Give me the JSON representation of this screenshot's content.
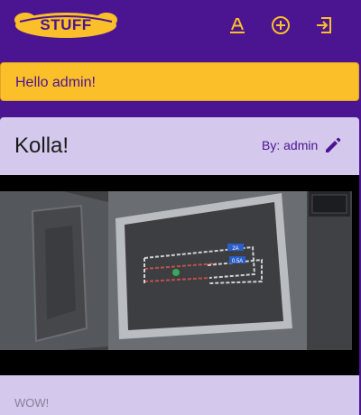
{
  "header": {
    "logo_text": "STUFF",
    "icons": [
      "font-icon",
      "add-circle-icon",
      "login-icon"
    ]
  },
  "banner": {
    "text": "Hello admin!"
  },
  "post": {
    "title": "Kolla!",
    "author": "By: admin",
    "body": "WOW!",
    "media": {
      "labels": [
        "2A",
        "0.5A"
      ]
    }
  },
  "colors": {
    "primary": "#4b1592",
    "accent": "#fbbf29",
    "card": "#d4c8ec"
  }
}
